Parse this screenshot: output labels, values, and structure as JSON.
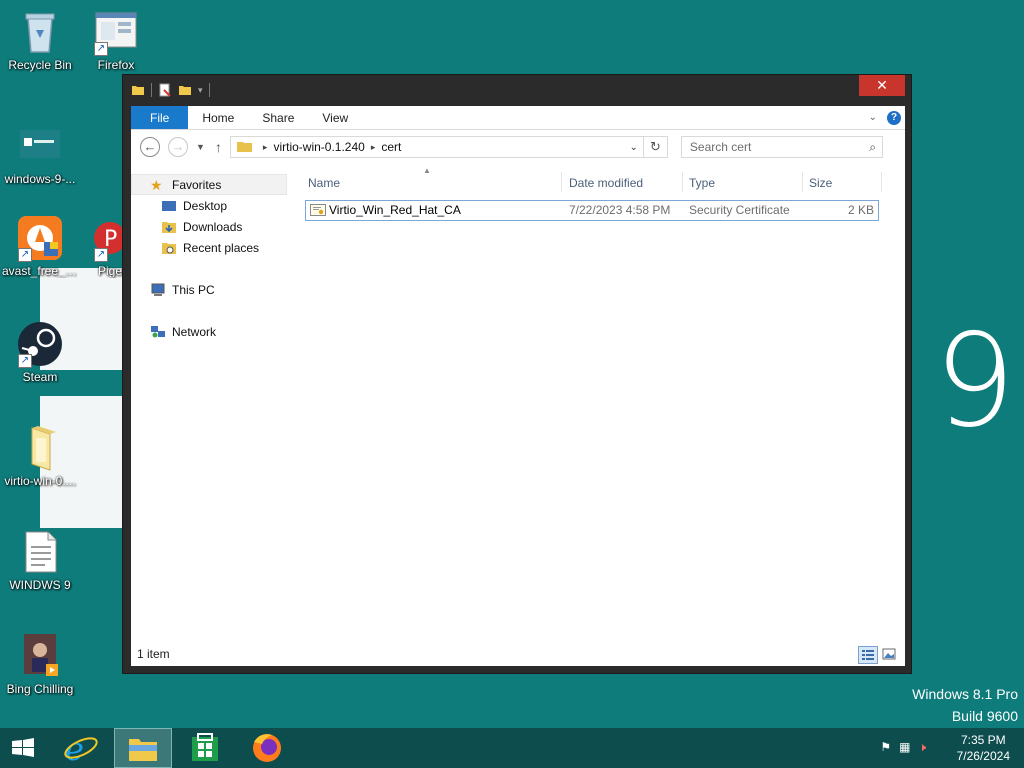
{
  "desktop": {
    "icons": [
      {
        "label": "Recycle Bin"
      },
      {
        "label": "Firefox"
      },
      {
        "label": "windows-9-..."
      },
      {
        "label": "avast_free_a..."
      },
      {
        "label": "Pige"
      },
      {
        "label": "Steam"
      },
      {
        "label": "virtio-win-0...."
      },
      {
        "label": "WINDWS 9"
      },
      {
        "label": "Bing Chilling"
      }
    ],
    "big_number": "9",
    "watermark_line1": "Windows 8.1 Pro",
    "watermark_line2": "Build 9600",
    "background_color": "#0e7c7b"
  },
  "explorer": {
    "close_glyph": "✕",
    "ribbon_tabs": [
      "File",
      "Home",
      "Share",
      "View"
    ],
    "help_glyph": "?",
    "address": {
      "crumbs": [
        "virtio-win-0.1.240",
        "cert"
      ]
    },
    "search": {
      "placeholder": "Search cert"
    },
    "nav": {
      "favorites": "Favorites",
      "desktop": "Desktop",
      "downloads": "Downloads",
      "recent": "Recent places",
      "this_pc": "This PC",
      "network": "Network"
    },
    "columns": {
      "name": "Name",
      "date": "Date modified",
      "type": "Type",
      "size": "Size"
    },
    "files": [
      {
        "name": "Virtio_Win_Red_Hat_CA",
        "date": "7/22/2023 4:58 PM",
        "type": "Security Certificate",
        "size": "2 KB"
      }
    ],
    "status": "1 item",
    "accent_color": "#1979ca"
  },
  "taskbar": {
    "time": "7:35 PM",
    "date": "7/26/2024",
    "pinned": [
      "start",
      "internet-explorer",
      "file-explorer",
      "store",
      "firefox"
    ]
  }
}
